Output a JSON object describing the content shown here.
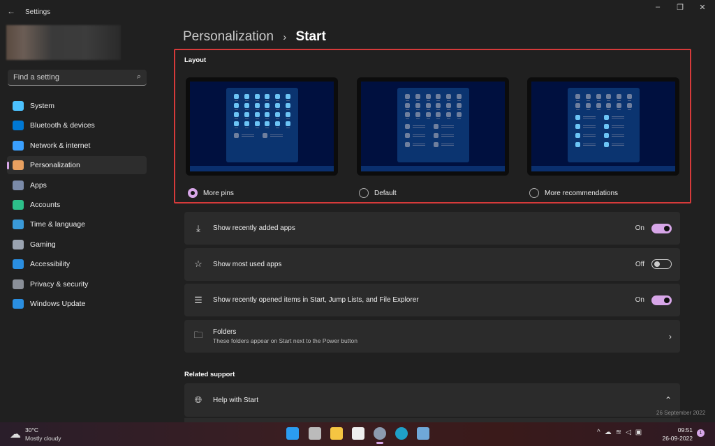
{
  "window": {
    "title": "Settings"
  },
  "search": {
    "placeholder": "Find a setting"
  },
  "sidebar": {
    "items": [
      {
        "label": "System",
        "color": "#4cc2ff"
      },
      {
        "label": "Bluetooth & devices",
        "color": "#0078d4"
      },
      {
        "label": "Network & internet",
        "color": "#3aa0ff"
      },
      {
        "label": "Personalization",
        "color": "#e8a060",
        "selected": true
      },
      {
        "label": "Apps",
        "color": "#7a8aa8"
      },
      {
        "label": "Accounts",
        "color": "#2dbf8a"
      },
      {
        "label": "Time & language",
        "color": "#3a9ad9"
      },
      {
        "label": "Gaming",
        "color": "#9aa3b0"
      },
      {
        "label": "Accessibility",
        "color": "#2a8ee0"
      },
      {
        "label": "Privacy & security",
        "color": "#8a8f98"
      },
      {
        "label": "Windows Update",
        "color": "#2a8ee0"
      }
    ]
  },
  "breadcrumb": {
    "parent": "Personalization",
    "sep": "›",
    "current": "Start"
  },
  "layout": {
    "heading": "Layout",
    "options": [
      {
        "label": "More pins",
        "selected": true,
        "pin_rows": 4,
        "rec_rows": 1,
        "highlight": "pins"
      },
      {
        "label": "Default",
        "selected": false,
        "pin_rows": 3,
        "rec_rows": 3,
        "highlight": "none"
      },
      {
        "label": "More recommendations",
        "selected": false,
        "pin_rows": 2,
        "rec_rows": 4,
        "highlight": "recs"
      }
    ]
  },
  "settings": [
    {
      "icon": "⤓",
      "label": "Show recently added apps",
      "state": "On",
      "on": true
    },
    {
      "icon": "☆",
      "label": "Show most used apps",
      "state": "Off",
      "on": false
    },
    {
      "icon": "☰",
      "label": "Show recently opened items in Start, Jump Lists, and File Explorer",
      "state": "On",
      "on": true
    },
    {
      "icon": "🗀",
      "label": "Folders",
      "sub": "These folders appear on Start next to the Power button"
    }
  ],
  "related": {
    "heading": "Related support",
    "help": "Help with Start"
  },
  "tooltip": "26 September 2022",
  "taskbar": {
    "temp": "30°C",
    "weather": "Mostly cloudy",
    "time": "09:51",
    "date": "26-09-2022",
    "badge": "1"
  }
}
